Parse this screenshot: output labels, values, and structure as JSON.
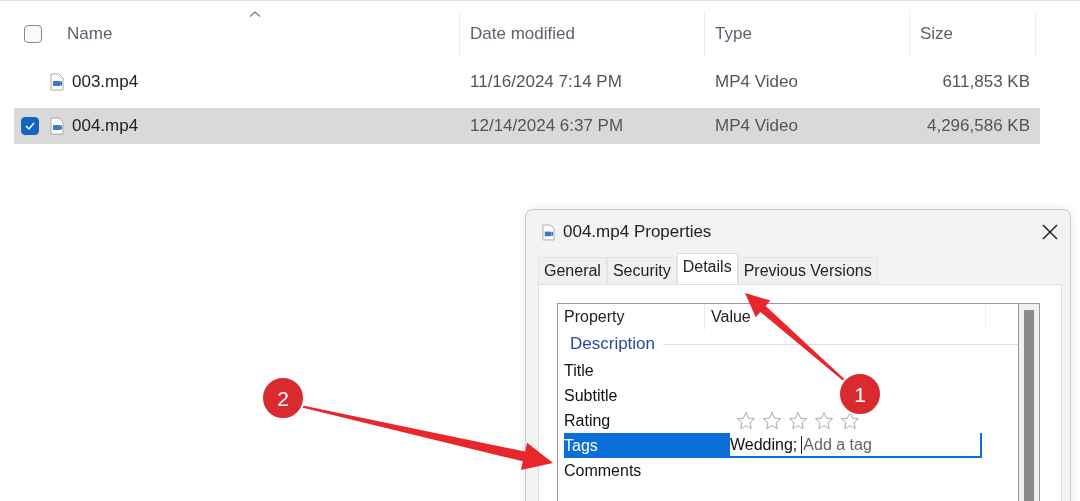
{
  "explorer": {
    "select_all_checked": false,
    "columns": [
      {
        "label": "Name",
        "sorted": true
      },
      {
        "label": "Date modified",
        "sorted": false
      },
      {
        "label": "Type",
        "sorted": false
      },
      {
        "label": "Size",
        "sorted": false
      }
    ],
    "rows": [
      {
        "name": "003.mp4",
        "date": "11/16/2024 7:14 PM",
        "type": "MP4 Video",
        "size": "611,853 KB",
        "selected": false
      },
      {
        "name": "004.mp4",
        "date": "12/14/2024 6:37 PM",
        "type": "MP4 Video",
        "size": "4,296,586 KB",
        "selected": true
      }
    ]
  },
  "dialog": {
    "title": "004.mp4 Properties",
    "tabs": [
      {
        "label": "General",
        "selected": false
      },
      {
        "label": "Security",
        "selected": false
      },
      {
        "label": "Details",
        "selected": true
      },
      {
        "label": "Previous Versions",
        "selected": false
      }
    ],
    "columns": [
      "Property",
      "Value"
    ],
    "section": "Description",
    "properties": [
      {
        "kind": "text",
        "name": "Title",
        "selected": false
      },
      {
        "kind": "text",
        "name": "Subtitle",
        "selected": false
      },
      {
        "kind": "rating",
        "name": "Rating",
        "stars": 0,
        "selected": false
      },
      {
        "kind": "edit",
        "name": "Tags",
        "value": "Wedding;",
        "placeholder": "Add a tag",
        "selected": true
      },
      {
        "kind": "text",
        "name": "Comments",
        "selected": false
      }
    ]
  },
  "callouts": [
    "2",
    "1"
  ]
}
